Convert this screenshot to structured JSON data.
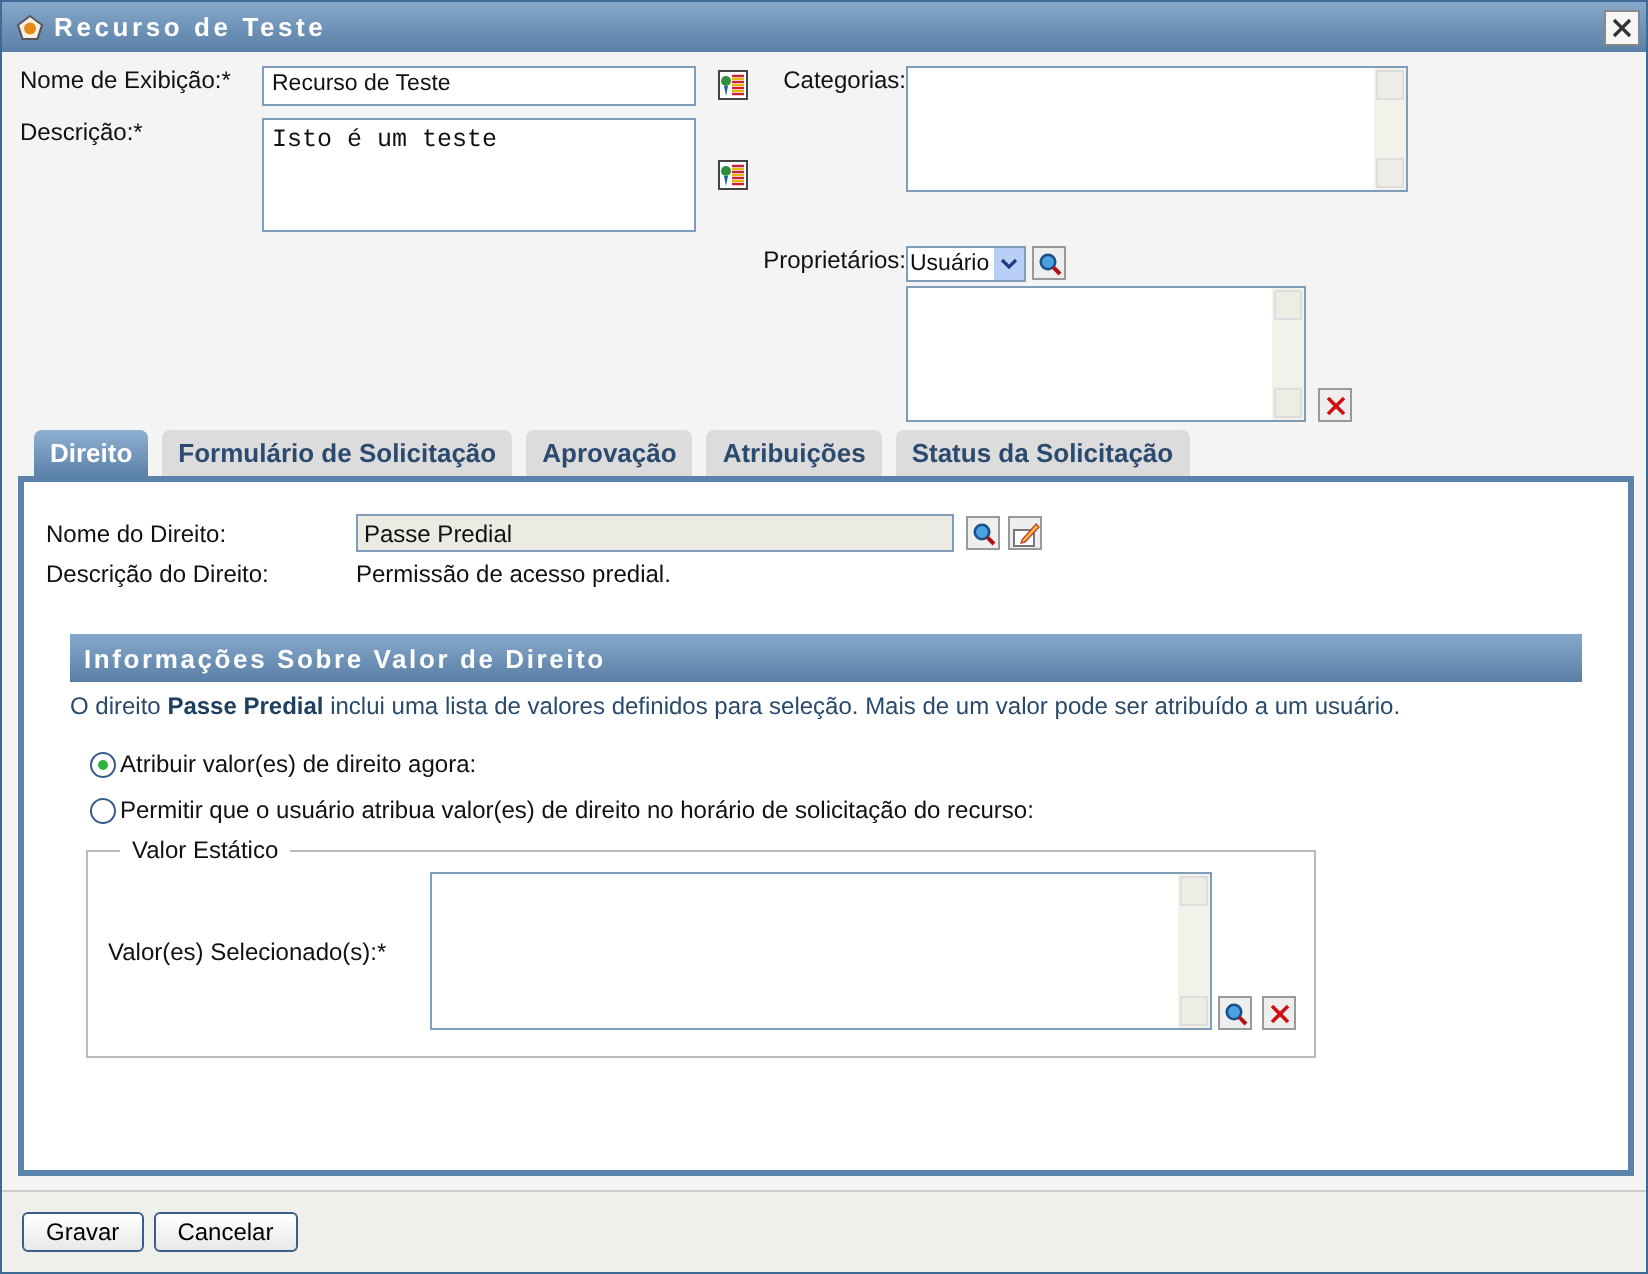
{
  "window": {
    "title": "Recurso de Teste"
  },
  "form": {
    "display_name": {
      "label": "Nome de Exibição:*",
      "value": "Recurso de Teste"
    },
    "description": {
      "label": "Descrição:*",
      "value": "Isto é um teste"
    },
    "categories": {
      "label": "Categorias:"
    },
    "owners": {
      "label": "Proprietários:",
      "type": "Usuário"
    }
  },
  "tabs": [
    {
      "label": "Direito",
      "selected": true
    },
    {
      "label": "Formulário de Solicitação",
      "selected": false
    },
    {
      "label": "Aprovação",
      "selected": false
    },
    {
      "label": "Atribuições",
      "selected": false
    },
    {
      "label": "Status da Solicitação",
      "selected": false
    }
  ],
  "entitlement": {
    "name_label": "Nome do Direito:",
    "name_value": "Passe Predial",
    "description_label": "Descrição do Direito:",
    "description_value": "Permissão de acesso predial.",
    "section_title": "Informações Sobre Valor de Direito",
    "info": "O direito **Passe Predial** inclui uma lista de valores definidos para seleção. Mais de um valor pode ser atribuído a um usuário.",
    "options": [
      {
        "label": "Atribuir valor(es) de direito agora:",
        "selected": true
      },
      {
        "label": "Permitir que o usuário atribua valor(es) de direito no horário de solicitação do recurso:",
        "selected": false
      }
    ],
    "static_value": {
      "legend": "Valor Estático",
      "label": "Valor(es) Selecionado(s):*"
    }
  },
  "buttons": [
    "Gravar",
    "Cancelar"
  ]
}
